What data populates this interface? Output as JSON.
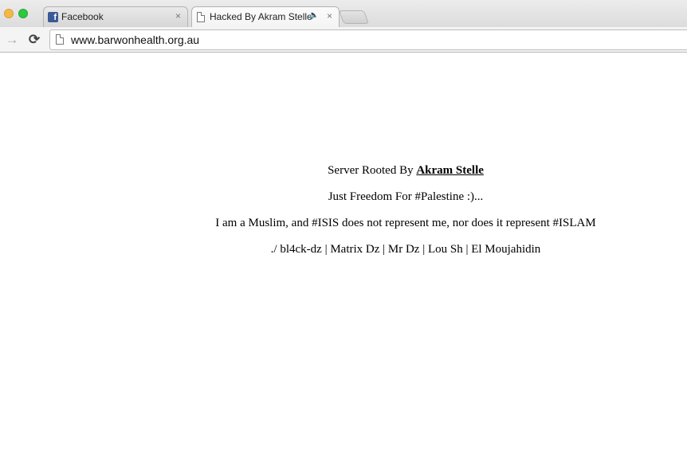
{
  "tabs": [
    {
      "label": "Facebook",
      "icon": "facebook-icon",
      "active": false,
      "close": "×"
    },
    {
      "label": "Hacked By Akram Stelle",
      "icon": "page-icon",
      "active": true,
      "close": "×",
      "audio_icon": "🔈"
    }
  ],
  "toolbar": {
    "forward_glyph": "→",
    "reload_glyph": "⟳",
    "url": "www.barwonhealth.org.au"
  },
  "content": {
    "line1_prefix": "Server Rooted By ",
    "line1_link": "Akram Stelle",
    "line2": "Just Freedom For #Palestine :)...",
    "line3": "I am a Muslim, and #ISIS does not represent me, nor does it represent #ISLAM",
    "line4": "./ bl4ck-dz | Matrix Dz | Mr Dz | Lou Sh | El Moujahidin"
  },
  "colors": {
    "traffic_minimize": "#f5b845",
    "traffic_maximize": "#2cc840",
    "facebook_blue": "#3b5998"
  }
}
